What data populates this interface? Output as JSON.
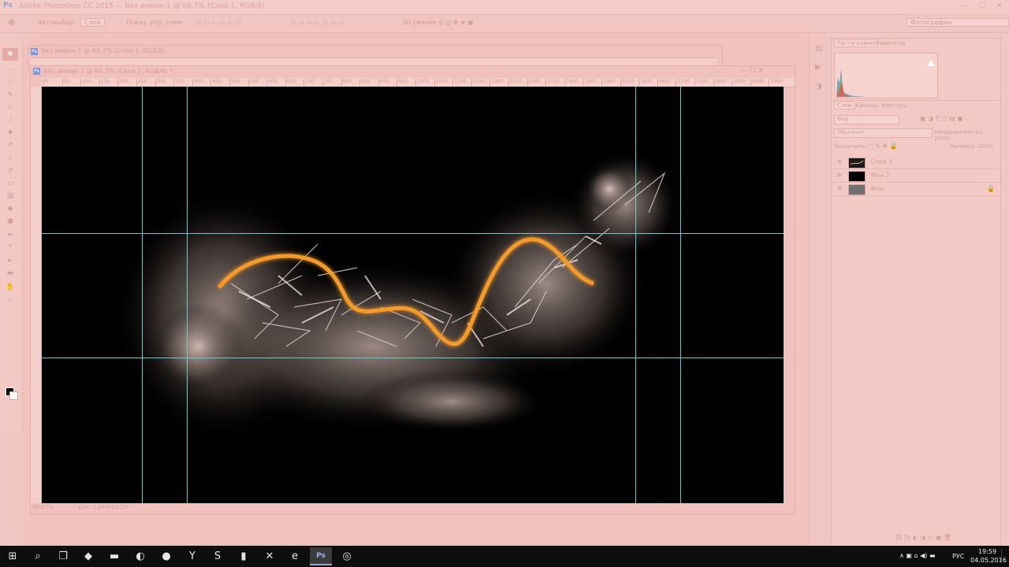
{
  "titlebar": {
    "app_icon": "Ps",
    "title": "Adobe Photoshop CC 2015 — Без имени-1 @ 66,7% (Слой 1, RGB/8)",
    "minimize": "—",
    "maximize": "☐",
    "close": "✕"
  },
  "options": {
    "auto_select_label": "Автовыбор:",
    "auto_select_value": "Слой",
    "transform_label": "Показ. упр. элем.",
    "mode_label": "3D-режим:",
    "workspace": "Фотография"
  },
  "tools": [
    {
      "name": "move-tool-icon",
      "glyph": "✥"
    },
    {
      "name": "marquee-tool-icon",
      "glyph": "⬚"
    },
    {
      "name": "lasso-tool-icon",
      "glyph": "◌"
    },
    {
      "name": "quick-select-tool-icon",
      "glyph": "✎"
    },
    {
      "name": "crop-tool-icon",
      "glyph": "⌗"
    },
    {
      "name": "eyedropper-tool-icon",
      "glyph": "⁄"
    },
    {
      "name": "healing-tool-icon",
      "glyph": "✚"
    },
    {
      "name": "brush-tool-icon",
      "glyph": "✐"
    },
    {
      "name": "stamp-tool-icon",
      "glyph": "⊥"
    },
    {
      "name": "history-brush-tool-icon",
      "glyph": "↺"
    },
    {
      "name": "eraser-tool-icon",
      "glyph": "▭"
    },
    {
      "name": "gradient-tool-icon",
      "glyph": "▤"
    },
    {
      "name": "blur-tool-icon",
      "glyph": "◆"
    },
    {
      "name": "dodge-tool-icon",
      "glyph": "●"
    },
    {
      "name": "pen-tool-icon",
      "glyph": "✒"
    },
    {
      "name": "type-tool-icon",
      "glyph": "T"
    },
    {
      "name": "path-select-tool-icon",
      "glyph": "▸"
    },
    {
      "name": "shape-tool-icon",
      "glyph": "▬"
    },
    {
      "name": "hand-tool-icon",
      "glyph": "✋"
    },
    {
      "name": "zoom-tool-icon",
      "glyph": "⌕"
    }
  ],
  "documents": {
    "back_tab": "Без имени-1 @ 66,7% (Слой 1, RGB/8)",
    "front_tab": "Без имени-1 @ 66,7% (Слой 1, RGB/8) *",
    "zoom": "66,67%",
    "doc_info": "Док: 2,64M/10,5M",
    "ruler_ticks": [
      "0",
      "50",
      "100",
      "150",
      "200",
      "250",
      "300",
      "350",
      "400",
      "450",
      "500",
      "550",
      "600",
      "650",
      "700",
      "750",
      "800",
      "850",
      "900",
      "950",
      "1000",
      "1050",
      "1100",
      "1150",
      "1200",
      "1250",
      "1300",
      "1350",
      "1400",
      "1450",
      "1500",
      "1550",
      "1600",
      "1650",
      "1700",
      "1750",
      "1800",
      "1850",
      "1900",
      "1950"
    ]
  },
  "right_panels": {
    "top_tabs": [
      "Гистограмма",
      "Навигатор"
    ],
    "layer_tabs": [
      "Слои",
      "Каналы",
      "Контуры"
    ],
    "kind_filter": "Вид",
    "blend_mode": "Обычные",
    "opacity_label": "Непрозрачность: 100%",
    "lock_label": "Закрепить:",
    "fill_label": "Заливка: 100%",
    "layers": [
      {
        "name": "Слой 1",
        "thumb_color": "#1a1a1a"
      },
      {
        "name": "Фон 2",
        "thumb_color": "#000000"
      },
      {
        "name": "Фон",
        "thumb_color": "#707070"
      }
    ]
  },
  "taskbar": {
    "apps": [
      {
        "name": "start-button",
        "glyph": "⊞"
      },
      {
        "name": "search-icon",
        "glyph": "⌕"
      },
      {
        "name": "task-view-icon",
        "glyph": "❐"
      },
      {
        "name": "shield-app-icon",
        "glyph": "◆"
      },
      {
        "name": "explorer-icon",
        "glyph": "▬"
      },
      {
        "name": "browser-app-icon",
        "glyph": "◐"
      },
      {
        "name": "utorrent-icon",
        "glyph": "●"
      },
      {
        "name": "yandex-browser-icon",
        "glyph": "Y"
      },
      {
        "name": "skype-icon",
        "glyph": "S"
      },
      {
        "name": "messenger-icon",
        "glyph": "▮"
      },
      {
        "name": "xbox-icon",
        "glyph": "✕"
      },
      {
        "name": "edge-icon",
        "glyph": "e"
      },
      {
        "name": "photoshop-taskbar-icon",
        "glyph": "Ps"
      },
      {
        "name": "chrome-icon",
        "glyph": "◎"
      }
    ],
    "lang": "РУС",
    "time": "19:59",
    "date": "04.05.2016"
  }
}
